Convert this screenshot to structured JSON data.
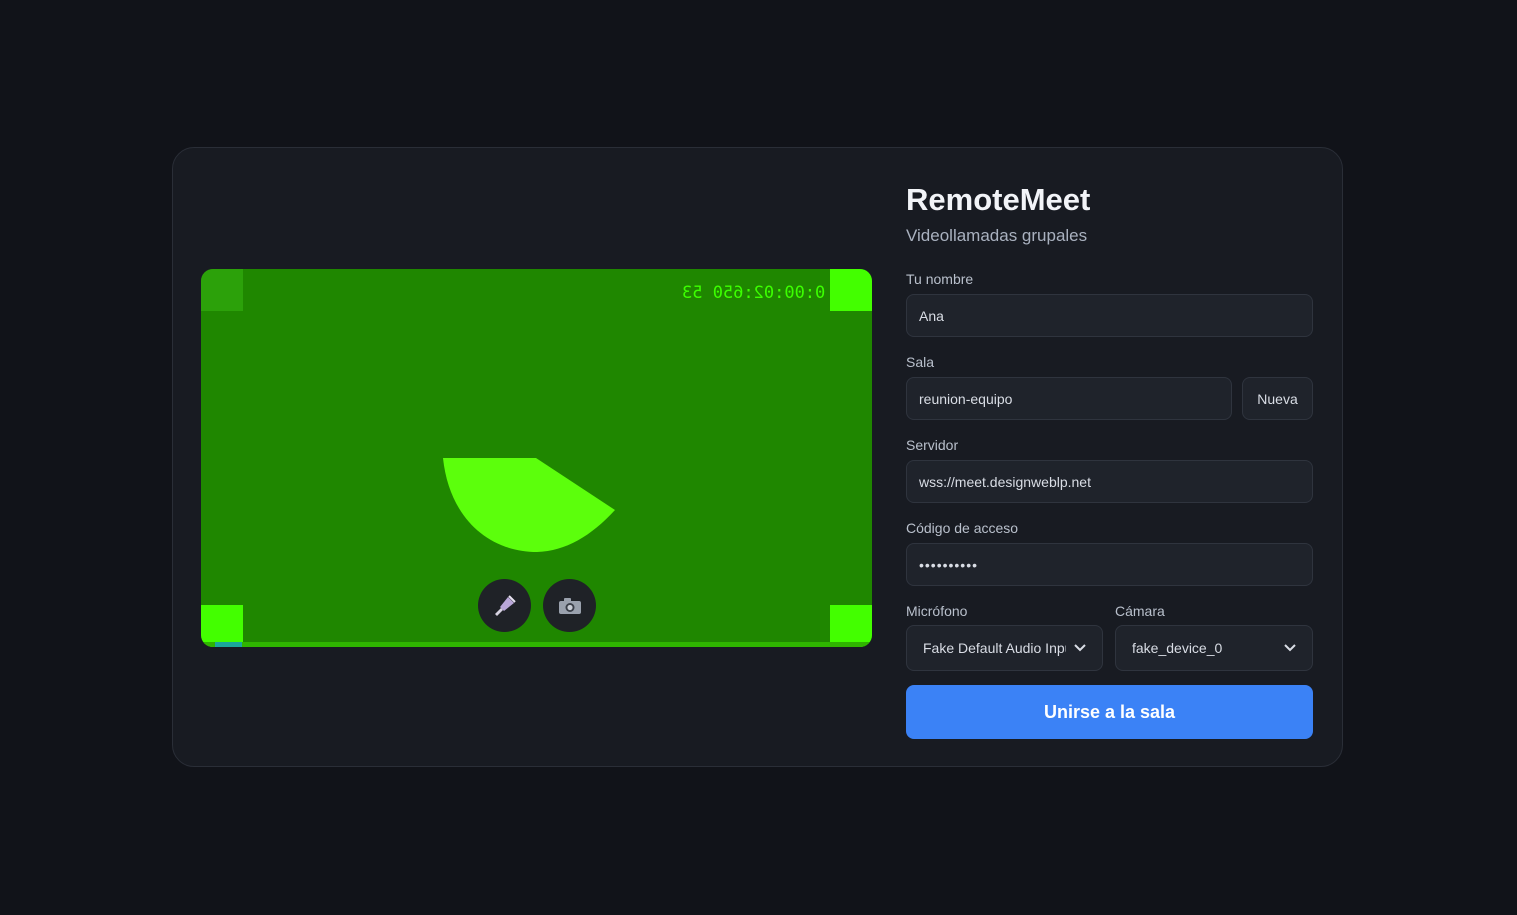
{
  "app": {
    "title": "RemoteMeet",
    "subtitle": "Videollamadas grupales"
  },
  "preview": {
    "timecode": "0:00:02:650 53",
    "progress_fraction": 0.04,
    "mic_icon": "microphone-icon",
    "camera_icon": "camera-icon"
  },
  "form": {
    "name": {
      "label": "Tu nombre",
      "value": "Ana"
    },
    "room": {
      "label": "Sala",
      "value": "reunion-equipo",
      "new_button": "Nueva"
    },
    "server": {
      "label": "Servidor",
      "value": "wss://meet.designweblp.net"
    },
    "access_code": {
      "label": "Código de acceso",
      "value": "••••••••••"
    },
    "microphone": {
      "label": "Micrófono",
      "value": "Fake Default Audio Input"
    },
    "camera": {
      "label": "Cámara",
      "value": "fake_device_0"
    },
    "join_button": "Unirse a la sala"
  },
  "colors": {
    "background": "#111319",
    "card": "#181b22",
    "accent": "#3b82f6",
    "preview_green": "#1f8700",
    "bright_green": "#43ff00"
  }
}
